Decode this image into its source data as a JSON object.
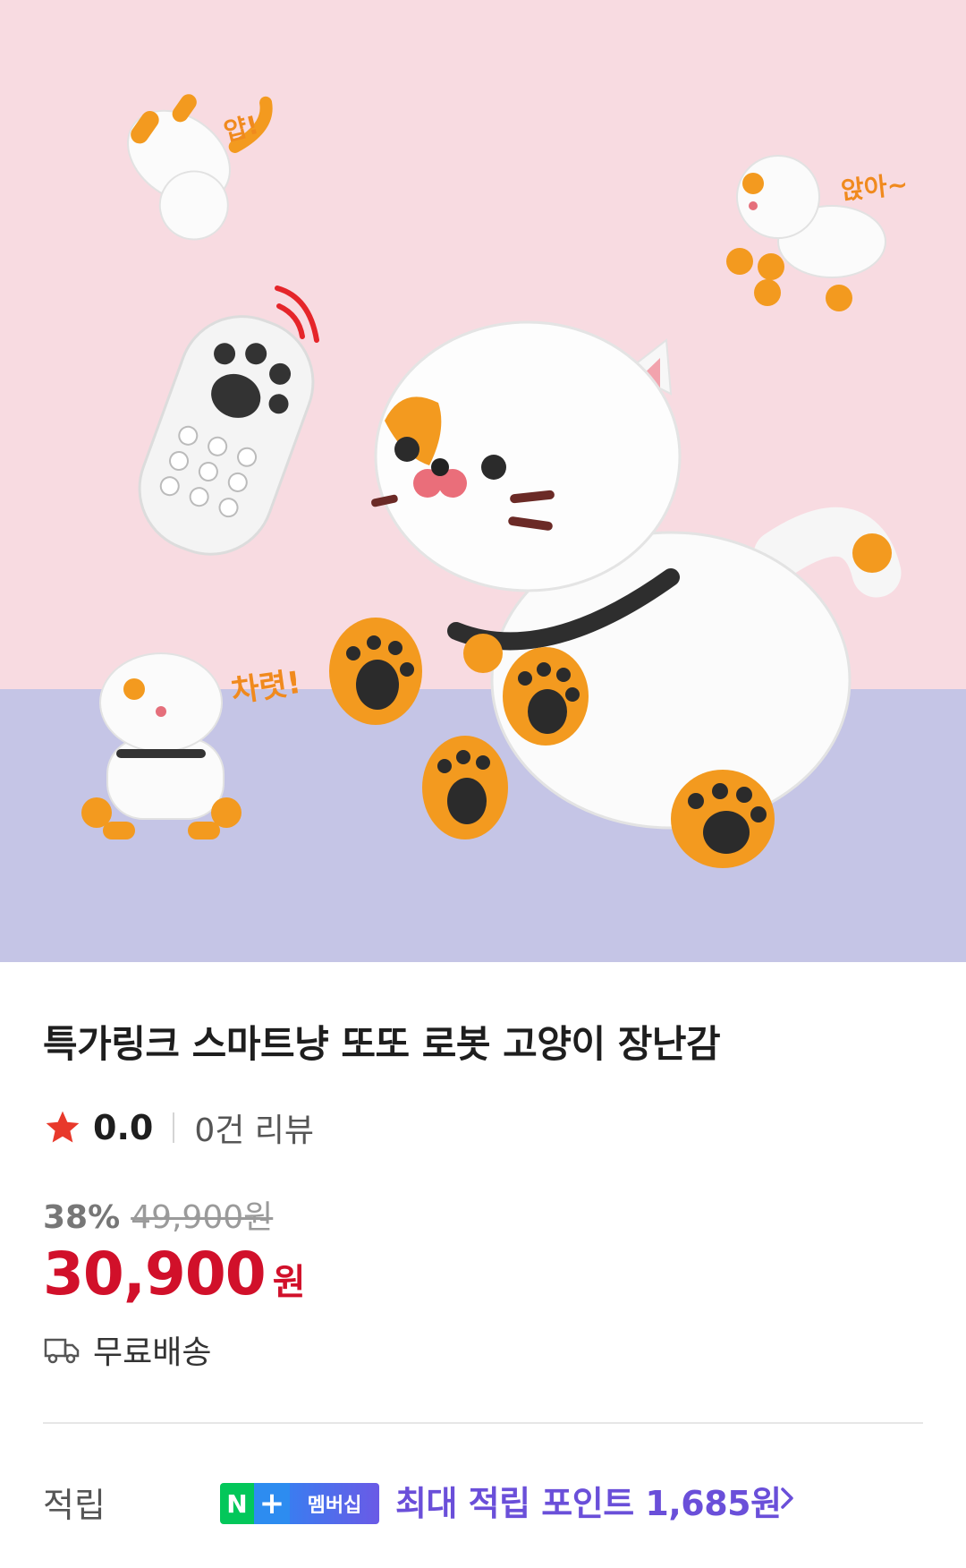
{
  "hero": {
    "speech_1": "얍!",
    "speech_2": "앉아~",
    "speech_3": "차렷!",
    "colors": {
      "top_bg": "#f8dbe1",
      "bottom_bg": "#c5c5e6",
      "accent_orange": "#f39a1f"
    }
  },
  "product": {
    "title": "특가링크 스마트냥 또또 로봇 고양이 장난감",
    "rating": "0.0",
    "review_count": "0건 리뷰",
    "discount_pct": "38%",
    "original_price": "49,900원",
    "price": "30,900",
    "currency": "원",
    "shipping": "무료배송"
  },
  "points": {
    "label": "적립",
    "badge_n": "N",
    "badge_plus": "+",
    "badge_text": "멤버십",
    "text": "최대 적립 포인트 1,685원",
    "colors": {
      "price_red": "#d1102a",
      "point_purple": "#6a4fd9",
      "naver_green": "#03c75a"
    }
  },
  "icons": [
    "star-icon",
    "truck-icon",
    "chevron-right-icon"
  ]
}
